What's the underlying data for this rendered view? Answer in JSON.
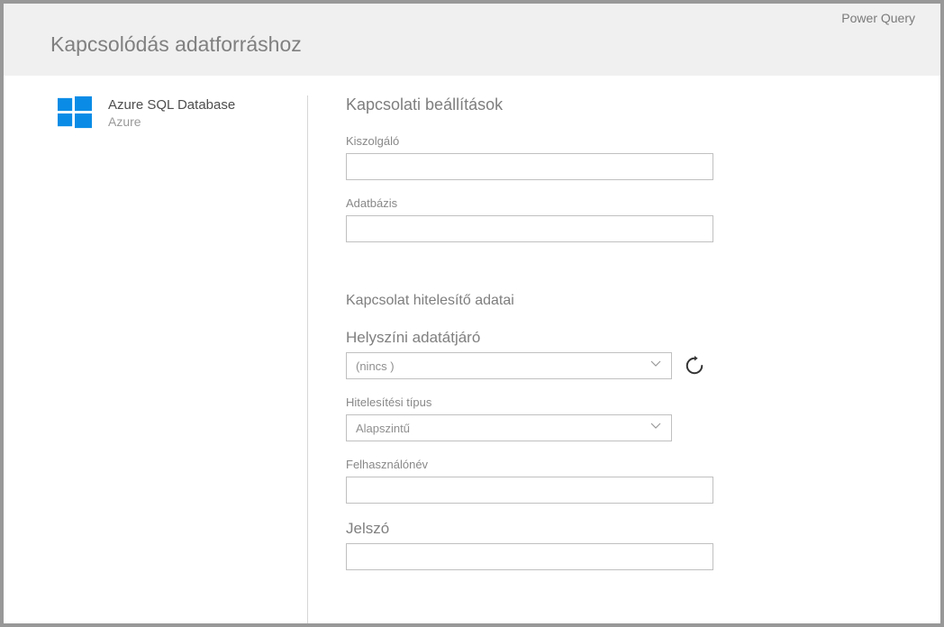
{
  "brand": "Power Query",
  "pageTitle": "Kapcsolódás adatforráshoz",
  "sidebar": {
    "connector": {
      "name": "Azure SQL Database",
      "category": "Azure"
    }
  },
  "main": {
    "settingsTitle": "Kapcsolati beállítások",
    "fields": {
      "server": {
        "label": "Kiszolgáló",
        "value": ""
      },
      "database": {
        "label": "Adatbázis",
        "value": ""
      }
    },
    "credentialsTitle": "Kapcsolat hitelesítő adatai",
    "gateway": {
      "label": "Helyszíni adatátjáró",
      "selected": "(nincs )"
    },
    "authType": {
      "label": "Hitelesítési típus",
      "selected": "Alapszintű"
    },
    "username": {
      "label": "Felhasználónév",
      "value": ""
    },
    "password": {
      "label": "Jelszó",
      "value": ""
    }
  }
}
